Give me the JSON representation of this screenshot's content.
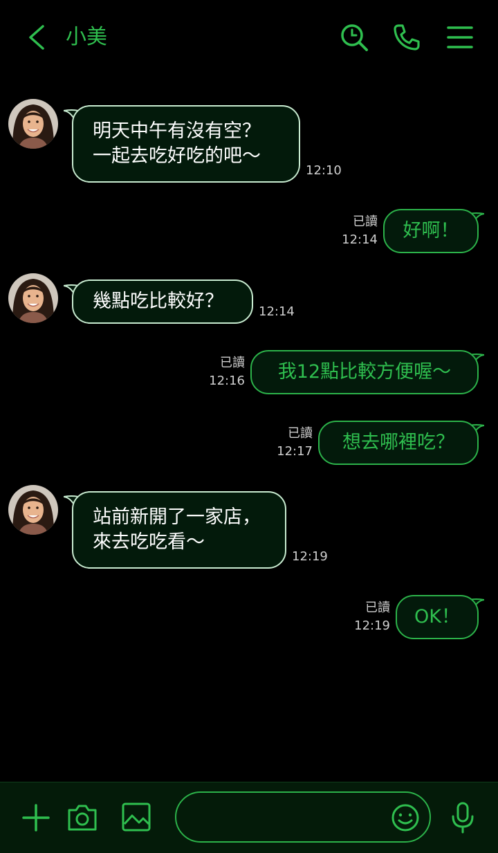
{
  "header": {
    "title": "小美",
    "icons": [
      "back-arrow-icon",
      "search-icon",
      "phone-icon",
      "menu-icon"
    ]
  },
  "messages": [
    {
      "dir": "in",
      "lines": [
        "明天中午有沒有空？",
        "一起去吃好吃的吧～"
      ],
      "time": "12:10"
    },
    {
      "dir": "out",
      "lines": [
        "好啊！"
      ],
      "read": "已讀",
      "time": "12:14"
    },
    {
      "dir": "in",
      "lines": [
        "幾點吃比較好？"
      ],
      "time": "12:14"
    },
    {
      "dir": "out",
      "lines": [
        "我12點比較方便喔～"
      ],
      "read": "已讀",
      "time": "12:16"
    },
    {
      "dir": "out",
      "lines": [
        "想去哪裡吃？"
      ],
      "read": "已讀",
      "time": "12:17"
    },
    {
      "dir": "in",
      "lines": [
        "站前新開了一家店，",
        "來去吃吃看～"
      ],
      "time": "12:19"
    },
    {
      "dir": "out",
      "lines": [
        "OK！"
      ],
      "read": "已讀",
      "time": "12:19"
    }
  ],
  "footer": {
    "input_value": "",
    "icons": [
      "plus-icon",
      "camera-icon",
      "image-icon",
      "emoji-icon",
      "microphone-icon"
    ]
  },
  "colors": {
    "accent": "#2fbf4f",
    "background": "#000000",
    "bubble_fill": "#031a0b",
    "incoming_border": "#c9ecd1",
    "footer_bg": "#041b09"
  }
}
